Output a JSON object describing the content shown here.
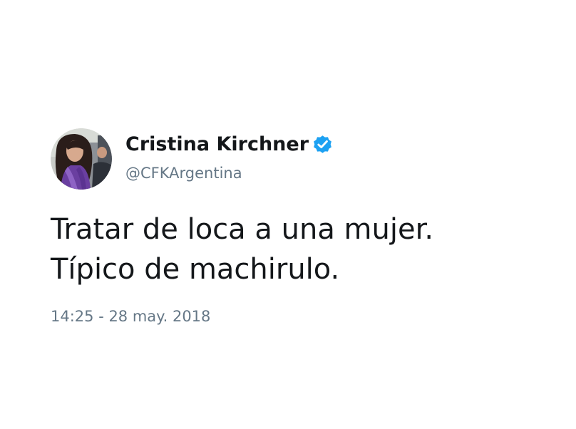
{
  "tweet": {
    "author": {
      "display_name": "Cristina Kirchner",
      "handle": "@CFKArgentina",
      "verified": true,
      "verified_icon": "verified-badge-icon"
    },
    "text_lines": [
      "Tratar de loca a una mujer.",
      "Típico de machirulo."
    ],
    "timestamp": "14:25 - 28 may. 2018"
  },
  "colors": {
    "background": "#ffffff",
    "text_primary": "#14171a",
    "text_secondary": "#657786",
    "verified_blue": "#1da1f2"
  }
}
